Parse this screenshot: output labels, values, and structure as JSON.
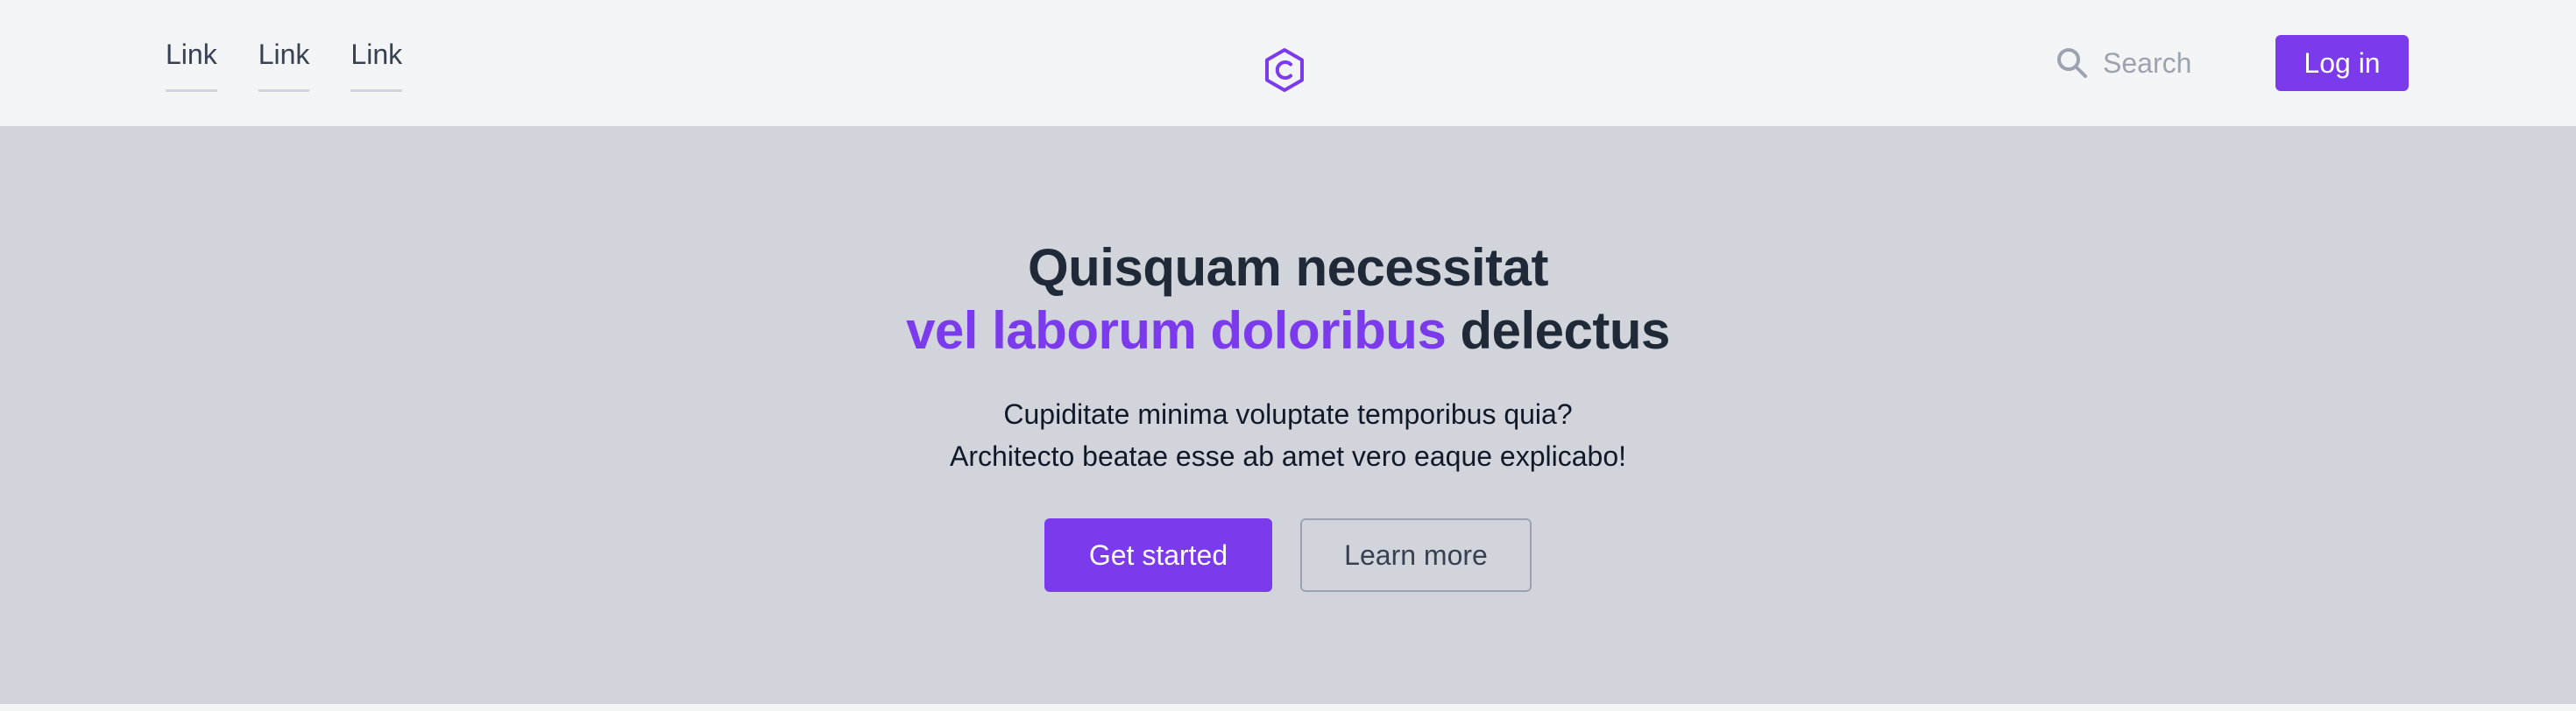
{
  "header": {
    "nav": [
      {
        "label": "Link"
      },
      {
        "label": "Link"
      },
      {
        "label": "Link"
      }
    ],
    "logo_icon": "hexagon-c-logo-icon",
    "search": {
      "label": "Search",
      "icon": "search-icon"
    },
    "login_label": "Log in"
  },
  "hero": {
    "title_line1": "Quisquam necessitat",
    "title_accent": "vel laborum doloribus",
    "title_rest": " delectus",
    "subtitle_line1": "Cupiditate minima voluptate temporibus quia?",
    "subtitle_line2": "Architecto beatae esse ab amet vero eaque explicabo!",
    "primary_cta": "Get started",
    "secondary_cta": "Learn more"
  },
  "colors": {
    "accent": "#7c3aed",
    "header_bg": "#f3f4f6",
    "hero_bg": "#d1d5db",
    "heading": "#1f2937",
    "muted": "#9ca3af"
  }
}
